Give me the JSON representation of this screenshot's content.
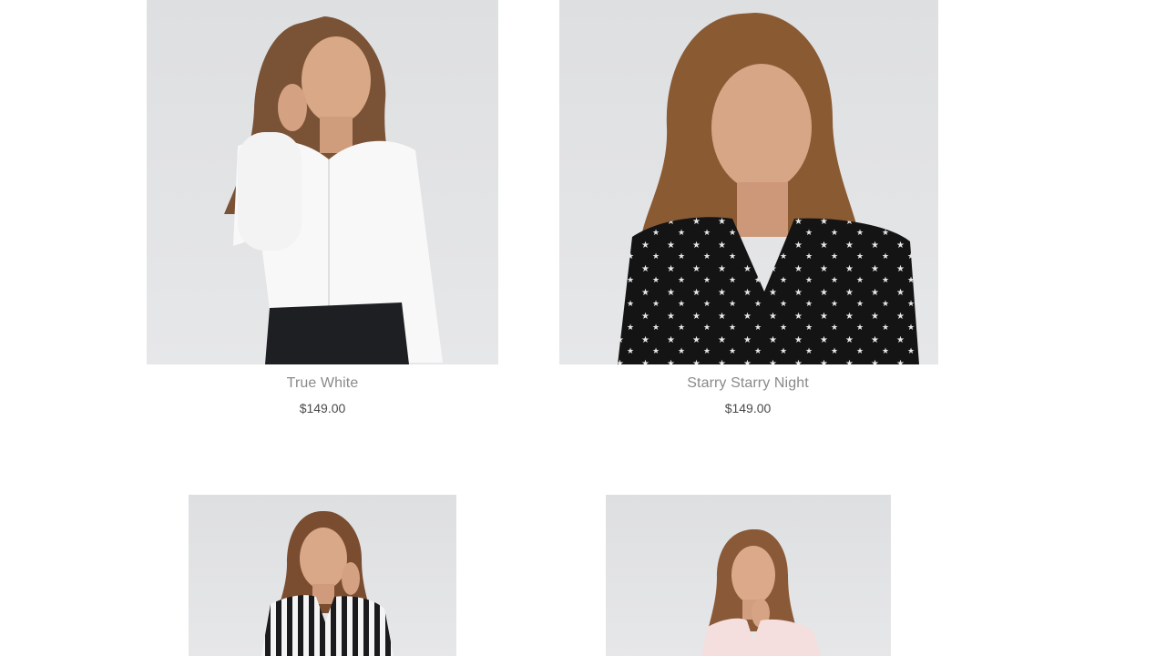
{
  "products": [
    {
      "title": "True White",
      "price": "$149.00",
      "image": "product-photo-white-blouse"
    },
    {
      "title": "Starry Starry Night",
      "price": "$149.00",
      "image": "product-photo-star-print-blouse"
    },
    {
      "title": "",
      "price": "",
      "image": "product-photo-striped-blouse"
    },
    {
      "title": "",
      "price": "",
      "image": "product-photo-pink-blouse"
    }
  ],
  "colors": {
    "photo_background": "#e2e3e5",
    "title_text": "#8a8a8a",
    "price_text": "#4a4a4a"
  }
}
